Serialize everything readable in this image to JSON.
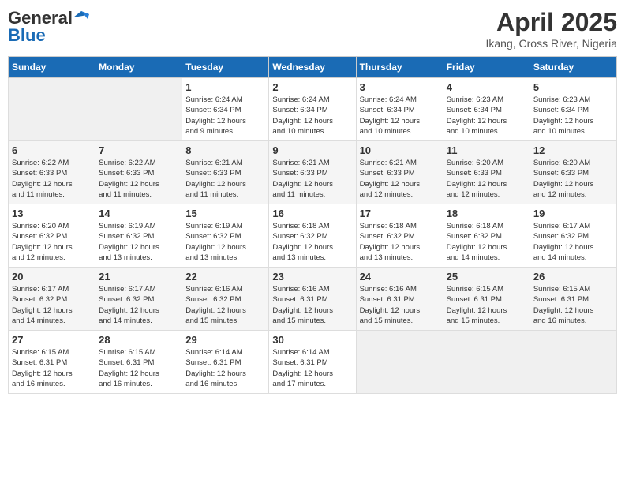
{
  "header": {
    "logo_line1": "General",
    "logo_line2": "Blue",
    "month_year": "April 2025",
    "location": "Ikang, Cross River, Nigeria"
  },
  "weekdays": [
    "Sunday",
    "Monday",
    "Tuesday",
    "Wednesday",
    "Thursday",
    "Friday",
    "Saturday"
  ],
  "weeks": [
    [
      {
        "day": "",
        "empty": true
      },
      {
        "day": "",
        "empty": true
      },
      {
        "day": "1",
        "sunrise": "6:24 AM",
        "sunset": "6:34 PM",
        "daylight": "12 hours and 9 minutes."
      },
      {
        "day": "2",
        "sunrise": "6:24 AM",
        "sunset": "6:34 PM",
        "daylight": "12 hours and 10 minutes."
      },
      {
        "day": "3",
        "sunrise": "6:24 AM",
        "sunset": "6:34 PM",
        "daylight": "12 hours and 10 minutes."
      },
      {
        "day": "4",
        "sunrise": "6:23 AM",
        "sunset": "6:34 PM",
        "daylight": "12 hours and 10 minutes."
      },
      {
        "day": "5",
        "sunrise": "6:23 AM",
        "sunset": "6:34 PM",
        "daylight": "12 hours and 10 minutes."
      }
    ],
    [
      {
        "day": "6",
        "sunrise": "6:22 AM",
        "sunset": "6:33 PM",
        "daylight": "12 hours and 11 minutes."
      },
      {
        "day": "7",
        "sunrise": "6:22 AM",
        "sunset": "6:33 PM",
        "daylight": "12 hours and 11 minutes."
      },
      {
        "day": "8",
        "sunrise": "6:21 AM",
        "sunset": "6:33 PM",
        "daylight": "12 hours and 11 minutes."
      },
      {
        "day": "9",
        "sunrise": "6:21 AM",
        "sunset": "6:33 PM",
        "daylight": "12 hours and 11 minutes."
      },
      {
        "day": "10",
        "sunrise": "6:21 AM",
        "sunset": "6:33 PM",
        "daylight": "12 hours and 12 minutes."
      },
      {
        "day": "11",
        "sunrise": "6:20 AM",
        "sunset": "6:33 PM",
        "daylight": "12 hours and 12 minutes."
      },
      {
        "day": "12",
        "sunrise": "6:20 AM",
        "sunset": "6:33 PM",
        "daylight": "12 hours and 12 minutes."
      }
    ],
    [
      {
        "day": "13",
        "sunrise": "6:20 AM",
        "sunset": "6:32 PM",
        "daylight": "12 hours and 12 minutes."
      },
      {
        "day": "14",
        "sunrise": "6:19 AM",
        "sunset": "6:32 PM",
        "daylight": "12 hours and 13 minutes."
      },
      {
        "day": "15",
        "sunrise": "6:19 AM",
        "sunset": "6:32 PM",
        "daylight": "12 hours and 13 minutes."
      },
      {
        "day": "16",
        "sunrise": "6:18 AM",
        "sunset": "6:32 PM",
        "daylight": "12 hours and 13 minutes."
      },
      {
        "day": "17",
        "sunrise": "6:18 AM",
        "sunset": "6:32 PM",
        "daylight": "12 hours and 13 minutes."
      },
      {
        "day": "18",
        "sunrise": "6:18 AM",
        "sunset": "6:32 PM",
        "daylight": "12 hours and 14 minutes."
      },
      {
        "day": "19",
        "sunrise": "6:17 AM",
        "sunset": "6:32 PM",
        "daylight": "12 hours and 14 minutes."
      }
    ],
    [
      {
        "day": "20",
        "sunrise": "6:17 AM",
        "sunset": "6:32 PM",
        "daylight": "12 hours and 14 minutes."
      },
      {
        "day": "21",
        "sunrise": "6:17 AM",
        "sunset": "6:32 PM",
        "daylight": "12 hours and 14 minutes."
      },
      {
        "day": "22",
        "sunrise": "6:16 AM",
        "sunset": "6:32 PM",
        "daylight": "12 hours and 15 minutes."
      },
      {
        "day": "23",
        "sunrise": "6:16 AM",
        "sunset": "6:31 PM",
        "daylight": "12 hours and 15 minutes."
      },
      {
        "day": "24",
        "sunrise": "6:16 AM",
        "sunset": "6:31 PM",
        "daylight": "12 hours and 15 minutes."
      },
      {
        "day": "25",
        "sunrise": "6:15 AM",
        "sunset": "6:31 PM",
        "daylight": "12 hours and 15 minutes."
      },
      {
        "day": "26",
        "sunrise": "6:15 AM",
        "sunset": "6:31 PM",
        "daylight": "12 hours and 16 minutes."
      }
    ],
    [
      {
        "day": "27",
        "sunrise": "6:15 AM",
        "sunset": "6:31 PM",
        "daylight": "12 hours and 16 minutes."
      },
      {
        "day": "28",
        "sunrise": "6:15 AM",
        "sunset": "6:31 PM",
        "daylight": "12 hours and 16 minutes."
      },
      {
        "day": "29",
        "sunrise": "6:14 AM",
        "sunset": "6:31 PM",
        "daylight": "12 hours and 16 minutes."
      },
      {
        "day": "30",
        "sunrise": "6:14 AM",
        "sunset": "6:31 PM",
        "daylight": "12 hours and 17 minutes."
      },
      {
        "day": "",
        "empty": true
      },
      {
        "day": "",
        "empty": true
      },
      {
        "day": "",
        "empty": true
      }
    ]
  ]
}
